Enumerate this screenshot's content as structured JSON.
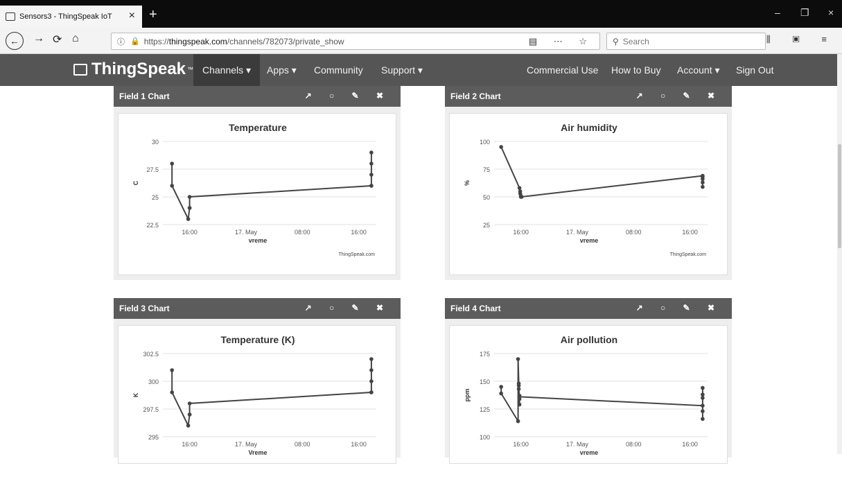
{
  "browser": {
    "tab_title": "Sensors3 - ThingSpeak IoT",
    "url_prefix": "https://",
    "url_domain": "thingspeak.com",
    "url_path": "/channels/782073/private_show",
    "search_placeholder": "Search"
  },
  "header": {
    "logo": "ThingSpeak",
    "logo_tm": "™",
    "nav": [
      {
        "label": "Channels ▾"
      },
      {
        "label": "Apps ▾"
      },
      {
        "label": "Community"
      },
      {
        "label": "Support ▾"
      },
      {
        "label": "Commercial Use"
      },
      {
        "label": "How to Buy"
      },
      {
        "label": "Account ▾"
      },
      {
        "label": "Sign Out"
      }
    ]
  },
  "panels": [
    {
      "title": "Field 1 Chart"
    },
    {
      "title": "Field 2 Chart"
    },
    {
      "title": "Field 3 Chart"
    },
    {
      "title": "Field 4 Chart"
    }
  ],
  "chart_data": [
    {
      "type": "line",
      "title": "Temperature",
      "xlabel": "vreme",
      "ylabel": "C",
      "credit": "ThingSpeak.com",
      "yticks": [
        "30",
        "27.5",
        "25",
        "22.5"
      ],
      "ylim": [
        22.5,
        30
      ],
      "xticks": [
        "16:00",
        "17. May",
        "08:00",
        "16:00"
      ],
      "x_tick_hours": [
        16,
        24,
        32,
        40
      ],
      "xlim_hours": [
        12.2,
        42.5
      ],
      "series": [
        {
          "x": [
            13.5,
            13.5,
            15.8,
            16.0,
            16.0,
            16.0,
            41.8,
            41.8,
            41.8,
            41.8,
            41.8
          ],
          "y": [
            28,
            26,
            23,
            24,
            24,
            25,
            26,
            26,
            27,
            28,
            29
          ]
        }
      ]
    },
    {
      "type": "line",
      "title": "Air humidity",
      "xlabel": "vreme",
      "ylabel": "%",
      "credit": "ThingSpeak.com",
      "yticks": [
        "100",
        "75",
        "50",
        "25"
      ],
      "ylim": [
        25,
        100
      ],
      "xticks": [
        "16:00",
        "17. May",
        "08:00",
        "16:00"
      ],
      "x_tick_hours": [
        16,
        24,
        32,
        40
      ],
      "xlim_hours": [
        12.2,
        42.5
      ],
      "series": [
        {
          "x": [
            13.2,
            15.8,
            15.9,
            15.9,
            16.0,
            16.0,
            16.1,
            41.8,
            41.8,
            41.8,
            41.8,
            41.8
          ],
          "y": [
            95,
            58,
            55,
            53,
            51,
            50,
            50,
            69,
            68,
            66,
            63,
            59
          ]
        }
      ]
    },
    {
      "type": "line",
      "title": "Temperature (K)",
      "xlabel": "Vreme",
      "ylabel": "K",
      "yticks": [
        "302.5",
        "300",
        "297.5",
        "295"
      ],
      "ylim": [
        295,
        302.5
      ],
      "xticks": [
        "16:00",
        "17. May",
        "08:00",
        "16:00"
      ],
      "x_tick_hours": [
        16,
        24,
        32,
        40
      ],
      "xlim_hours": [
        12.2,
        42.5
      ],
      "series": [
        {
          "x": [
            13.5,
            13.5,
            15.8,
            16.0,
            16.0,
            16.0,
            41.8,
            41.8,
            41.8,
            41.8,
            41.8
          ],
          "y": [
            301,
            299,
            296,
            297,
            297,
            298,
            299,
            299,
            300,
            301,
            302
          ]
        }
      ]
    },
    {
      "type": "line",
      "title": "Air pollution",
      "xlabel": "vreme",
      "ylabel": "ppm",
      "yticks": [
        "175",
        "150",
        "125",
        "100"
      ],
      "ylim": [
        100,
        175
      ],
      "xticks": [
        "16:00",
        "17. May",
        "08:00",
        "16:00"
      ],
      "x_tick_hours": [
        16,
        24,
        32,
        40
      ],
      "xlim_hours": [
        12.2,
        42.5
      ],
      "series": [
        {
          "x": [
            13.2,
            13.2,
            15.6,
            15.6,
            15.7,
            15.7,
            15.7,
            15.8,
            15.8,
            15.8,
            15.8,
            41.8,
            41.8,
            41.8,
            41.8,
            41.8,
            41.8
          ],
          "y": [
            145,
            139,
            114,
            170,
            148,
            146,
            143,
            137,
            134,
            129,
            136,
            128,
            144,
            138,
            135,
            123,
            116
          ]
        }
      ]
    }
  ]
}
